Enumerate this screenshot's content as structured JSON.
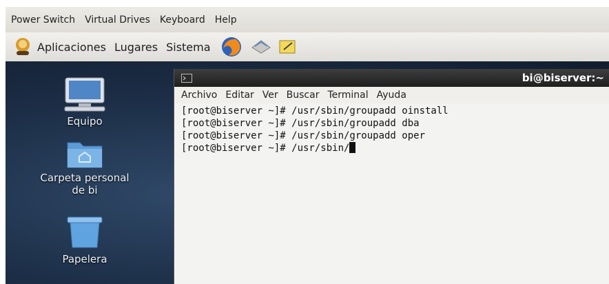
{
  "host_menubar": {
    "items": [
      "Power Switch",
      "Virtual Drives",
      "Keyboard",
      "Help"
    ]
  },
  "panel": {
    "menus": [
      "Aplicaciones",
      "Lugares",
      "Sistema"
    ],
    "icons": [
      "gnome-foot-icon",
      "firefox-icon",
      "mail-icon",
      "notes-icon"
    ]
  },
  "desktop": {
    "icons": [
      {
        "label": "Equipo",
        "icon": "computer-icon"
      },
      {
        "label": "Carpeta personal de bi",
        "icon": "home-folder-icon"
      },
      {
        "label": "Papelera",
        "icon": "trash-icon"
      }
    ]
  },
  "terminal": {
    "title": "bi@biserver:~",
    "menu": [
      "Archivo",
      "Editar",
      "Ver",
      "Buscar",
      "Terminal",
      "Ayuda"
    ],
    "lines": [
      "[root@biserver ~]# /usr/sbin/groupadd oinstall",
      "[root@biserver ~]# /usr/sbin/groupadd dba",
      "[root@biserver ~]# /usr/sbin/groupadd oper",
      "[root@biserver ~]# /usr/sbin/"
    ]
  }
}
